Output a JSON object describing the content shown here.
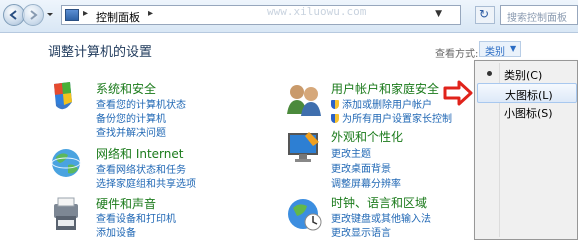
{
  "address_bar": {
    "crumb": "控制面板",
    "ghost_text": "www.xiluowu.com",
    "search_placeholder": "搜索控制面板"
  },
  "header": {
    "title": "调整计算机的设置",
    "view_by_label": "查看方式:",
    "view_by_value": "类别"
  },
  "categories": [
    {
      "title": "系统和安全",
      "links": [
        "查看您的计算机状态",
        "备份您的计算机",
        "查找并解决问题"
      ]
    },
    {
      "title": "网络和 Internet",
      "links": [
        "查看网络状态和任务",
        "选择家庭组和共享选项"
      ]
    },
    {
      "title": "硬件和声音",
      "links": [
        "查看设备和打印机",
        "添加设备"
      ]
    },
    {
      "title": "用户帐户和家庭安全",
      "links": [
        "添加或删除用户帐户",
        "为所有用户设置家长控制"
      ]
    },
    {
      "title": "外观和个性化",
      "links": [
        "更改主题",
        "更改桌面背景",
        "调整屏幕分辨率"
      ]
    },
    {
      "title": "时钟、语言和区域",
      "links": [
        "更改键盘或其他输入法",
        "更改显示语言"
      ]
    }
  ],
  "view_menu": {
    "items": [
      "类别(C)",
      "大图标(L)",
      "小图标(S)"
    ],
    "selected_index": 0,
    "highlighted_index": 1
  },
  "colors": {
    "link": "#2168b5",
    "category_title": "#1a7a1a",
    "arrow": "#e0231b"
  },
  "icons": [
    "back-icon",
    "forward-icon",
    "refresh-icon",
    "search-icon",
    "control-panel-icon",
    "system-security-icon",
    "network-icon",
    "hardware-sound-icon",
    "user-accounts-icon",
    "appearance-icon",
    "clock-language-icon",
    "uac-shield-icon"
  ]
}
